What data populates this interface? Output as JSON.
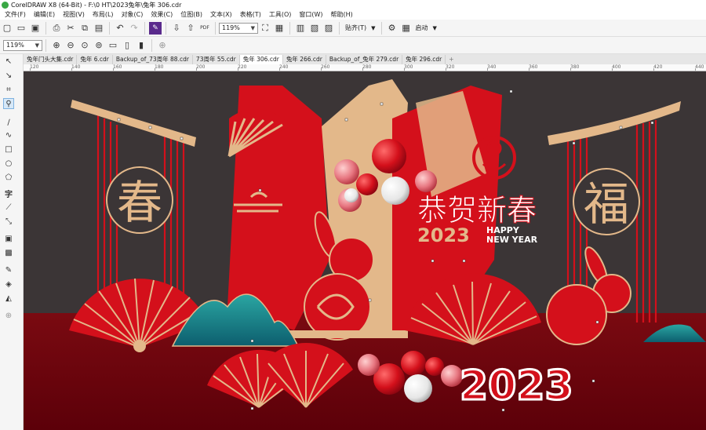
{
  "window": {
    "title": "CorelDRAW X8 (64-Bit) - F:\\0 HT\\2023兔年\\兔年 306.cdr"
  },
  "menu": [
    "文件(F)",
    "编辑(E)",
    "视图(V)",
    "布局(L)",
    "对象(C)",
    "效果(C)",
    "位图(B)",
    "文本(X)",
    "表格(T)",
    "工具(O)",
    "窗口(W)",
    "帮助(H)"
  ],
  "toolbar1": {
    "zoom_value": "119%",
    "snap_label": "贴齐(T)",
    "launch_label": "启动"
  },
  "toolbar2": {
    "zoom_value": "119%"
  },
  "tabs": [
    {
      "label": "兔年门头大集.cdr",
      "active": false
    },
    {
      "label": "兔年 6.cdr",
      "active": false
    },
    {
      "label": "Backup_of_73周年 88.cdr",
      "active": false
    },
    {
      "label": "73周年 55.cdr",
      "active": false
    },
    {
      "label": "兔年 306.cdr",
      "active": true
    },
    {
      "label": "兔年 266.cdr",
      "active": false
    },
    {
      "label": "Backup_of_兔年 279.cdr",
      "active": false
    },
    {
      "label": "兔年 296.cdr",
      "active": false
    }
  ],
  "ruler": {
    "labels": [
      "120",
      "140",
      "160",
      "180",
      "200",
      "220",
      "240",
      "260",
      "280",
      "300",
      "320",
      "340",
      "360",
      "380",
      "400",
      "420",
      "440"
    ]
  },
  "artwork": {
    "chars": {
      "spring": "春",
      "fortune": "福"
    },
    "greeting": "恭贺新春",
    "year_small": "2023",
    "happy_line1": "HAPPY",
    "happy_line2": "NEW YEAR",
    "year_large": "2023"
  },
  "colors": {
    "background": "#3b3536",
    "red": "#d4101b",
    "gold": "#e3b88a",
    "floor": "#8c0a12",
    "teal": "#1e8a8c"
  }
}
